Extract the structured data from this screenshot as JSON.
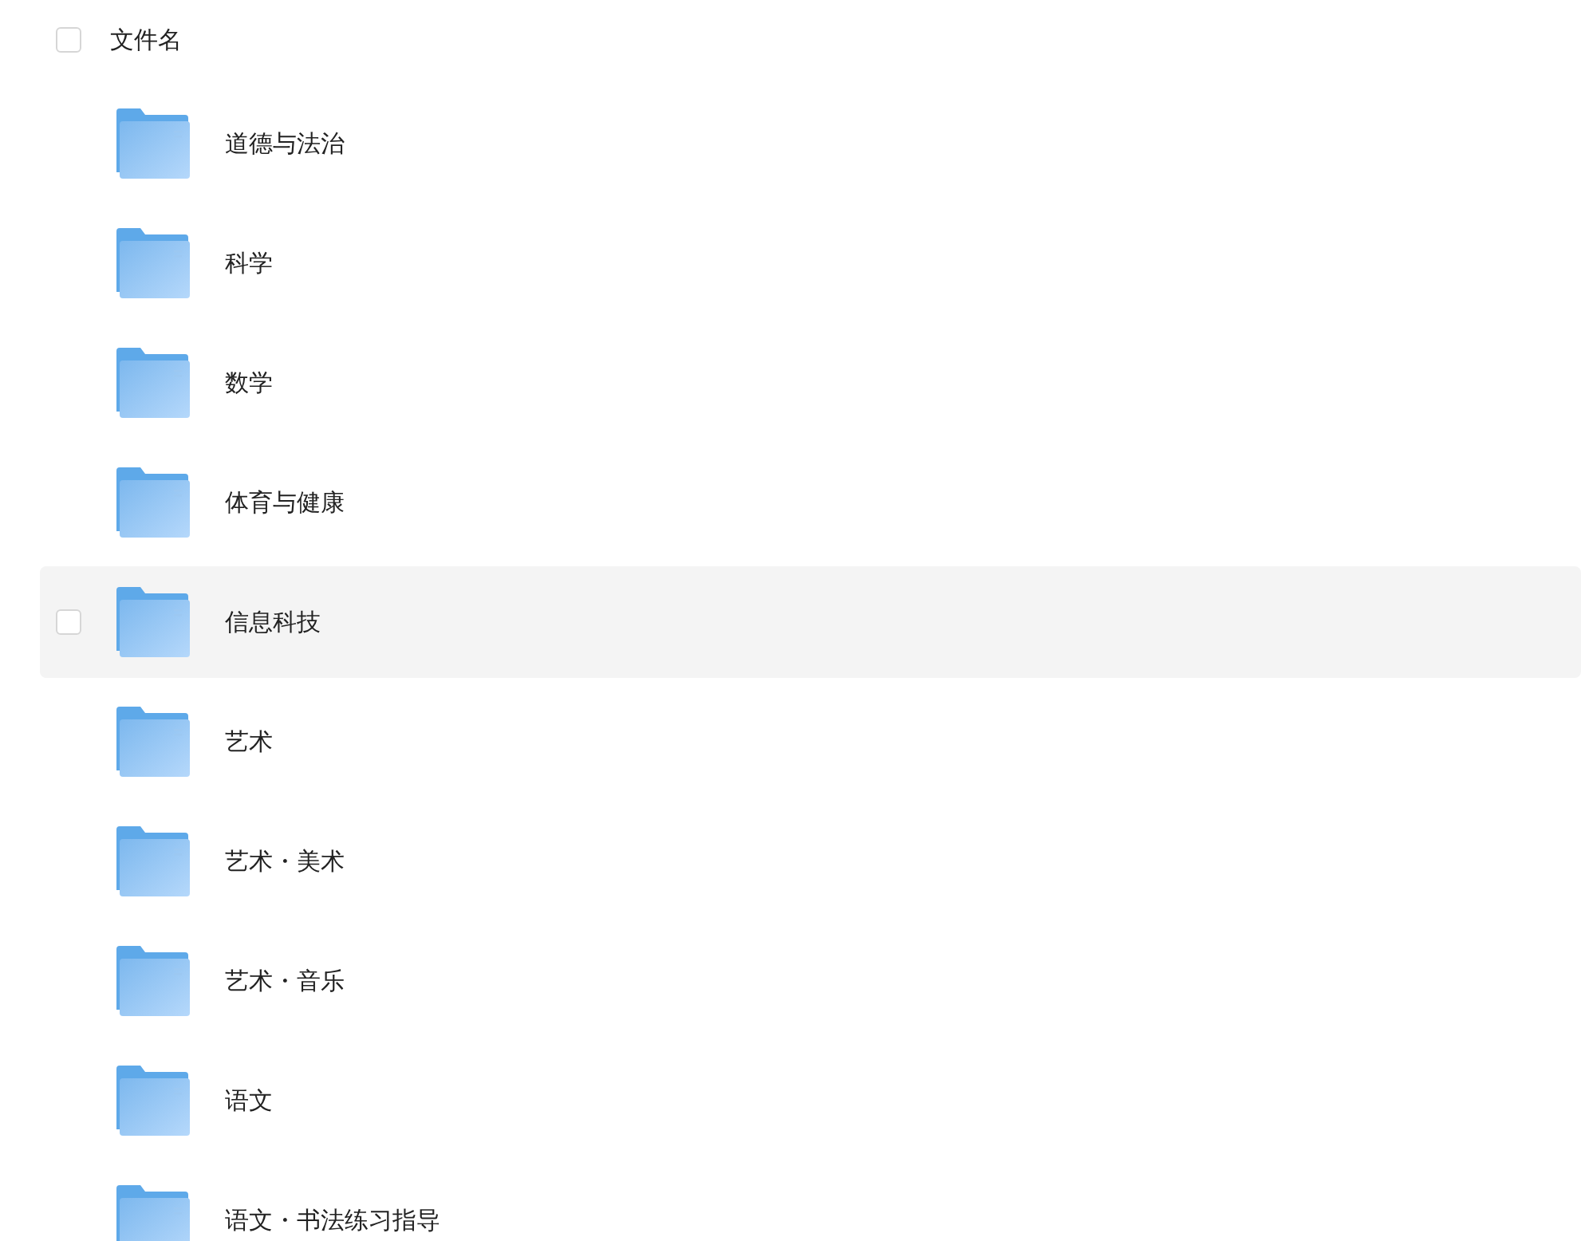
{
  "header": {
    "label": "文件名",
    "checked": false
  },
  "rows": [
    {
      "name": "道德与法治",
      "hovered": false,
      "checked": false
    },
    {
      "name": "科学",
      "hovered": false,
      "checked": false
    },
    {
      "name": "数学",
      "hovered": false,
      "checked": false
    },
    {
      "name": "体育与健康",
      "hovered": false,
      "checked": false
    },
    {
      "name": "信息科技",
      "hovered": true,
      "checked": false
    },
    {
      "name": "艺术",
      "hovered": false,
      "checked": false
    },
    {
      "name": "艺术・美术",
      "hovered": false,
      "checked": false
    },
    {
      "name": "艺术・音乐",
      "hovered": false,
      "checked": false
    },
    {
      "name": "语文",
      "hovered": false,
      "checked": false
    },
    {
      "name": "语文・书法练习指导",
      "hovered": false,
      "checked": false
    }
  ]
}
